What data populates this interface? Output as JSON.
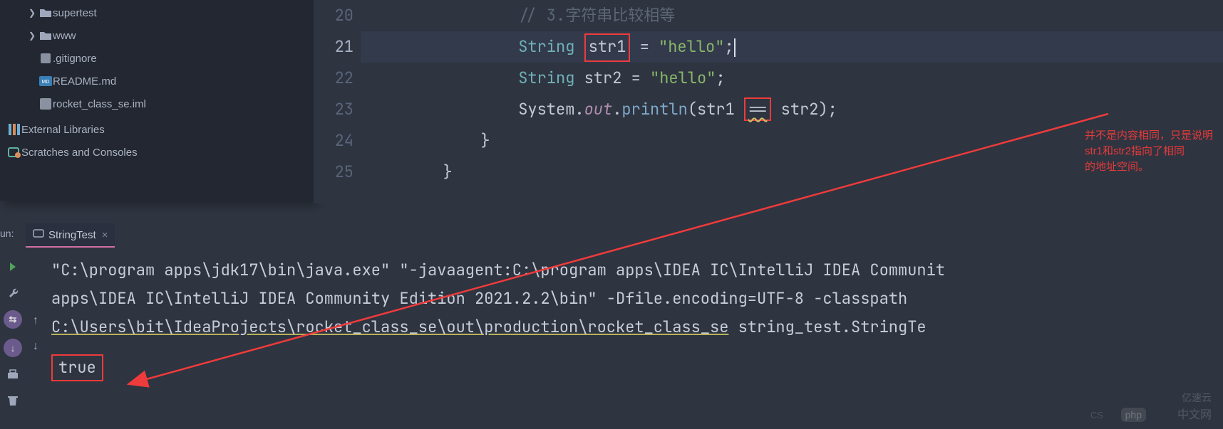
{
  "tree": {
    "items": [
      {
        "label": "supertest",
        "icon": "folder"
      },
      {
        "label": "www",
        "icon": "folder"
      },
      {
        "label": ".gitignore",
        "icon": "git"
      },
      {
        "label": "README.md",
        "icon": "md"
      },
      {
        "label": "rocket_class_se.iml",
        "icon": "iml"
      }
    ],
    "ext_lib": "External Libraries",
    "scratch": "Scratches and Consoles"
  },
  "editor": {
    "lines": [
      "20",
      "21",
      "22",
      "23",
      "24",
      "25"
    ],
    "comment20": "// 3.字符串比较相等",
    "type": "String",
    "v1": "str1",
    "v2": "str2",
    "eq": "=",
    "lit": "\"hello\"",
    "semi": ";",
    "sys": "System",
    "dot": ".",
    "out": "out",
    "println": "println",
    "lp": "(",
    "rp": ")",
    "cmp": "==",
    "brace": "}",
    "annotation_l1": "并不是内容相同，只是说明str1和str2指向了相同",
    "annotation_l2": "的地址空间。"
  },
  "run": {
    "label": "un:",
    "tab": "StringTest",
    "cmd_l1": "\"C:\\program apps\\jdk17\\bin\\java.exe\" \"-javaagent:C:\\program apps\\IDEA IC\\IntelliJ IDEA Communit",
    "cmd_l2": " apps\\IDEA IC\\IntelliJ IDEA Community Edition 2021.2.2\\bin\" -Dfile.encoding=UTF-8 -classpath ",
    "cmd_l3a": "C:\\Users\\bit\\IdeaProjects\\rocket_class_se\\out\\production\\rocket_class_se",
    "cmd_l3b": " string_test.StringTe",
    "output": "true"
  },
  "watermarks": {
    "w1a": "php",
    "w1b": "中文网",
    "w2": "亿速云",
    "w3": "CS"
  }
}
